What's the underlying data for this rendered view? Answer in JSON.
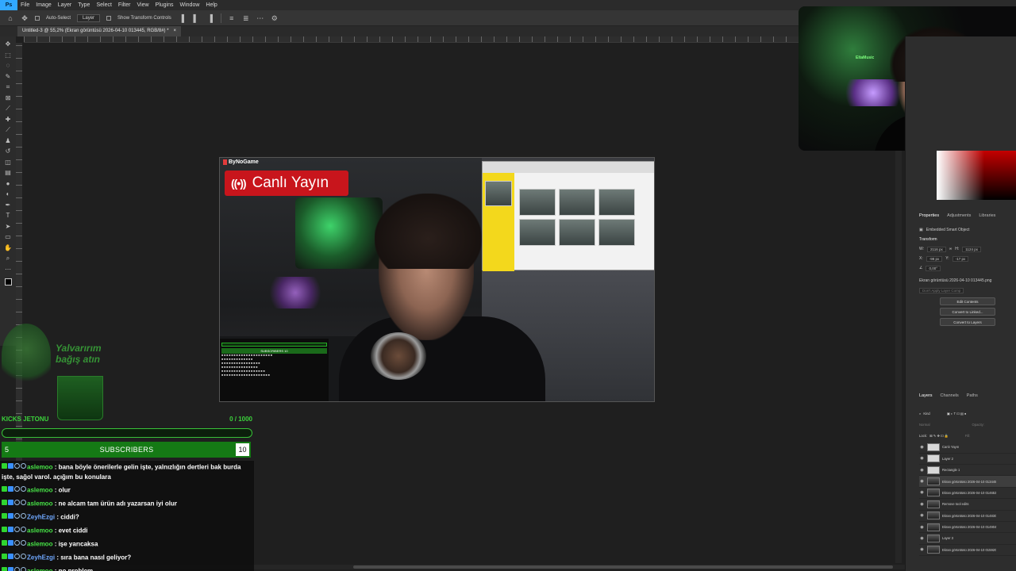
{
  "menu": [
    "File",
    "Image",
    "Layer",
    "Type",
    "Select",
    "Filter",
    "View",
    "Plugins",
    "Window",
    "Help"
  ],
  "options_bar": {
    "auto_select_label": "Auto-Select",
    "auto_select_target": "Layer",
    "show_transform_controls_label": "Show Transform Controls"
  },
  "document_tab": {
    "title": "Untitled-3 @ 55,2% (Ekran görüntüsü 2026-04-10 013445, RGB/8#) *",
    "close": "×"
  },
  "canvas_content": {
    "brand": "ByNoGame",
    "live_badge": "Canlı Yayın",
    "live_icon": "((•))",
    "inner_chat_subscribers": "SUBSCRIBERS",
    "inner_chat_count": "10"
  },
  "webcam": {
    "sign_text": "EltaMusic"
  },
  "panels": {
    "properties_tabs": [
      "Properties",
      "Adjustments",
      "Libraries"
    ],
    "smart_object_label": "Embedded Smart Object",
    "transform_label": "Transform",
    "w_label": "W:",
    "w_value": "2116 px",
    "h_label": "H:",
    "h_value": "1124 px",
    "x_label": "X:",
    "x_value": "-98 px",
    "y_label": "Y:",
    "y_value": "-17 px",
    "angle_value": "0,00°",
    "file_name": "Ekran görüntüsü 2026-04-10 013445.png",
    "layer_comp": "Don't Apply Layer Comp",
    "buttons": [
      "Edit Contents",
      "Convert to Linked...",
      "Convert to Layers"
    ],
    "layers_tabs": [
      "Layers",
      "Channels",
      "Paths"
    ],
    "kind_label": "Kind",
    "blend_mode": "Normal",
    "opacity_label": "Opacity:",
    "lock_label": "Lock:",
    "fill_label": "Fill:",
    "layers": [
      {
        "name": "Canlı Yayın",
        "thumb": "white",
        "selected": false
      },
      {
        "name": "Layer 2",
        "thumb": "white",
        "selected": false
      },
      {
        "name": "Rectangle 1",
        "thumb": "white",
        "selected": false
      },
      {
        "name": "Ekran görüntüsü 2026-04-10 013445",
        "thumb": "img",
        "selected": true
      },
      {
        "name": "Ekran görüntüsü 2026-04-10 014653",
        "thumb": "img",
        "selected": false
      },
      {
        "name": "Remove tool edits",
        "thumb": "img",
        "selected": false
      },
      {
        "name": "Ekran görüntüsü 2026-04-10 014830",
        "thumb": "img",
        "selected": false
      },
      {
        "name": "Ekran görüntüsü 2026-04-10 014904",
        "thumb": "img",
        "selected": false
      },
      {
        "name": "Layer 3",
        "thumb": "img",
        "selected": false
      },
      {
        "name": "Ekran görüntüsü 2026-04-10 015920",
        "thumb": "img",
        "selected": false
      }
    ]
  },
  "stream_overlay": {
    "donate_line1": "Yalvarırım",
    "donate_line2": "bağış atın",
    "kick_label": "KICKS JETONU",
    "kick_progress": "0 / 1000",
    "kick_progress_fraction": 0,
    "subs_left": "5",
    "subs_label": "SUBSCRIBERS",
    "subs_right": "10"
  },
  "chat": [
    {
      "user": "aslemoo",
      "color": "green",
      "msg": "bana böyle önerilerle gelin işte, yalnızlığın dertleri bak burda işte, sağol varol. açığım bu konulara"
    },
    {
      "user": "aslemoo",
      "color": "green",
      "msg": "olur"
    },
    {
      "user": "aslemoo",
      "color": "green",
      "msg": "ne alcam tam ürün adı yazarsan iyi olur"
    },
    {
      "user": "ZeyhEzgi",
      "color": "blue",
      "msg": "ciddi?"
    },
    {
      "user": "aslemoo",
      "color": "green",
      "msg": "evet ciddi"
    },
    {
      "user": "aslemoo",
      "color": "green",
      "msg": "işe yarıcaksa"
    },
    {
      "user": "ZeyhEzgi",
      "color": "blue",
      "msg": "sıra bana nasıl geliyor?"
    },
    {
      "user": "aslemoo",
      "color": "green",
      "msg": "no problem"
    }
  ],
  "colors": {
    "accent_green": "#38c138",
    "live_red": "#c8151c",
    "ps_blue": "#31a8ff"
  }
}
